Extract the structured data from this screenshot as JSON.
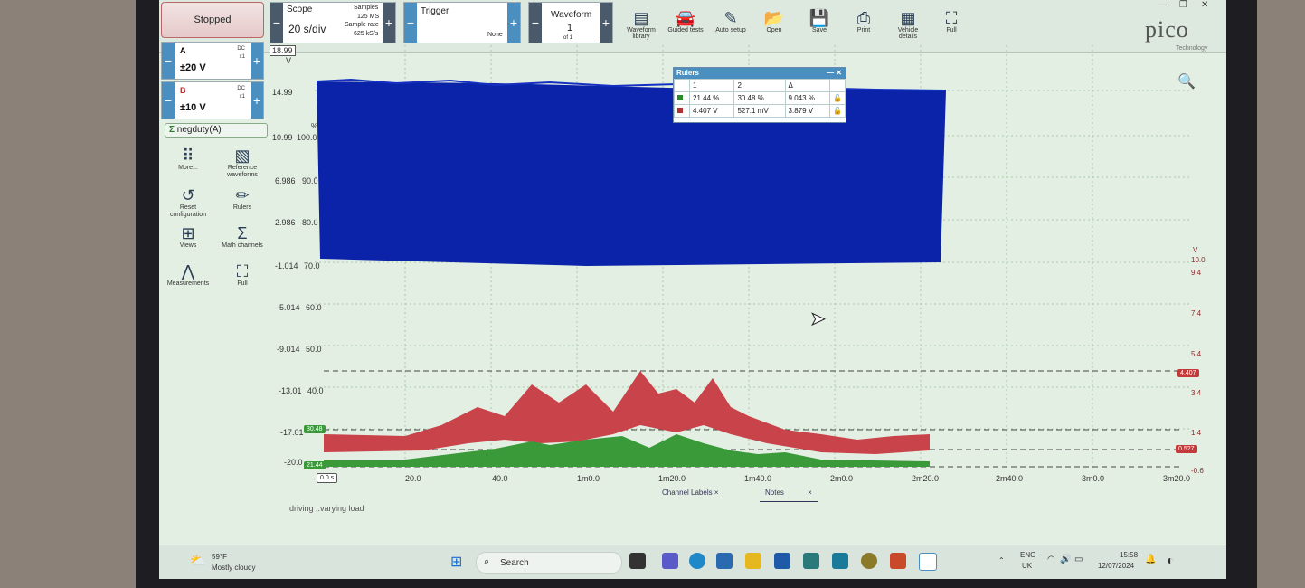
{
  "toolbar": {
    "stopped_label": "Stopped",
    "scope_label": "Scope",
    "timebase": "20 s/div",
    "samples_label": "Samples",
    "samples_value": "125 MS",
    "sample_rate_label": "Sample rate",
    "sample_rate_value": "625 kS/s",
    "trigger_label": "Trigger",
    "trigger_mode": "None",
    "waveform_label": "Waveform",
    "waveform_index": "1",
    "waveform_of": "of 1",
    "items": [
      {
        "label": "Waveform library",
        "icon": "book-stack-icon"
      },
      {
        "label": "Guided tests",
        "icon": "car-icon"
      },
      {
        "label": "Auto setup",
        "icon": "wand-icon"
      },
      {
        "label": "Open",
        "icon": "folder-icon"
      },
      {
        "label": "Save",
        "icon": "save-icon"
      },
      {
        "label": "Print",
        "icon": "printer-icon"
      },
      {
        "label": "Vehicle details",
        "icon": "clipboard-icon"
      },
      {
        "label": "Full",
        "icon": "fullscreen-icon"
      }
    ]
  },
  "logo": {
    "text": "pico",
    "sub": "Technology"
  },
  "channels": [
    {
      "name": "A",
      "coupling": "DC",
      "probe": "x1",
      "range": "±20 V"
    },
    {
      "name": "B",
      "coupling": "DC",
      "probe": "x1",
      "range": "±10 V"
    }
  ],
  "math_channel": "negduty(A)",
  "side_tools": [
    {
      "label": "More...",
      "icon": "grid-dots-icon"
    },
    {
      "label": "Reference waveforms",
      "icon": "reference-waveform-icon"
    },
    {
      "label": "Reset configuration",
      "icon": "reset-icon"
    },
    {
      "label": "Rulers",
      "icon": "ruler-icon"
    },
    {
      "label": "Views",
      "icon": "views-icon"
    },
    {
      "label": "Math channels",
      "icon": "sigma-icon"
    },
    {
      "label": "Measurements",
      "icon": "calipers-icon"
    },
    {
      "label": "Full",
      "icon": "fullscreen-icon"
    }
  ],
  "left_axis": [
    "18.99",
    "14.99",
    "10.99",
    "6.986",
    "2.986",
    "-1.014",
    "-5.014",
    "-9.014",
    "-13.01",
    "-17.01",
    "-20.0"
  ],
  "left_axis_unit": "V",
  "pct_axis": [
    "100.0",
    "90.0",
    "80.0",
    "70.0",
    "60.0",
    "50.0",
    "40.0"
  ],
  "pct_axis_unit": "%",
  "right_axis": [
    "10.0",
    "9.4",
    "7.4",
    "5.4",
    "3.4",
    "1.4",
    "-0.6"
  ],
  "right_axis_unit": "V",
  "ruler_tags": {
    "pct_top": "30.48",
    "pct_bottom": "21.44",
    "volt_top": "4.407",
    "volt_bottom": "0.527",
    "origin": "0.0 s"
  },
  "x_axis": [
    "20.0",
    "40.0",
    "1m0.0",
    "1m20.0",
    "1m40.0",
    "2m0.0",
    "2m20.0",
    "2m40.0",
    "3m0.0",
    "3m20.0"
  ],
  "rulers": {
    "title": "Rulers",
    "headers": [
      "1",
      "2",
      "Δ"
    ],
    "rows": [
      {
        "color": "#2a8a2a",
        "v1": "21.44 %",
        "v2": "30.48 %",
        "d": "9.043 %"
      },
      {
        "color": "#b23030",
        "v1": "4.407 V",
        "v2": "527.1 mV",
        "d": "3.879 V"
      }
    ]
  },
  "tabs": [
    "Channel Labels",
    "Notes"
  ],
  "note_text": "driving ..varying load",
  "taskbar": {
    "weather_temp": "59°F",
    "weather_desc": "Mostly cloudy",
    "search_placeholder": "Search",
    "lang1": "ENG",
    "lang2": "UK",
    "time": "15:58",
    "date": "12/07/2024"
  },
  "colors": {
    "channel_a": "#0a23a8",
    "channel_b": "#c23a3a",
    "math": "#3a9a3a",
    "accent": "#4a8fbf"
  }
}
